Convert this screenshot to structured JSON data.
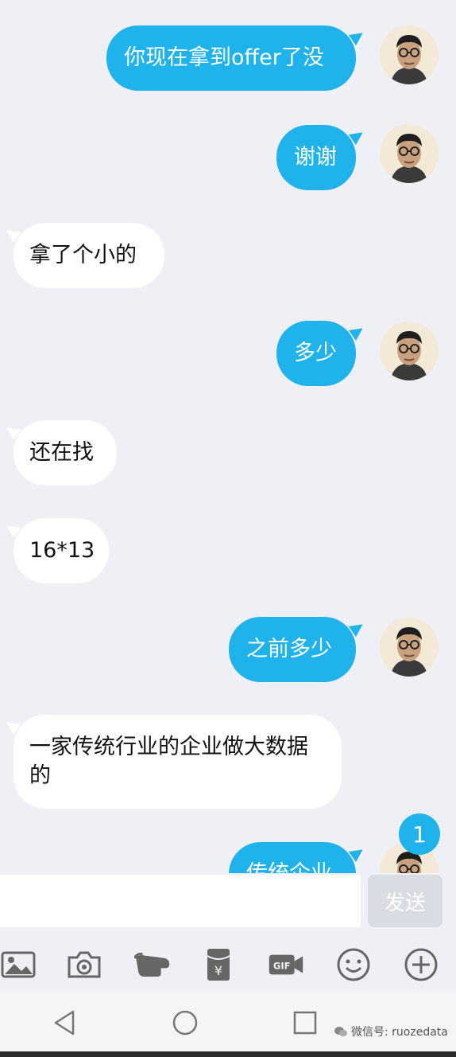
{
  "messages": [
    {
      "side": "sent",
      "text": "你现在拿到offer了没"
    },
    {
      "side": "sent",
      "text": "谢谢"
    },
    {
      "side": "recv",
      "text": "拿了个小的"
    },
    {
      "side": "sent",
      "text": "多少"
    },
    {
      "side": "recv",
      "text": "还在找"
    },
    {
      "side": "recv",
      "text": "16*13"
    },
    {
      "side": "sent",
      "text": "之前多少"
    },
    {
      "side": "recv",
      "text": "一家传统行业的企业做大数据的"
    },
    {
      "side": "sent",
      "text": "传统企业"
    }
  ],
  "unread_badge": "1",
  "input": {
    "value": "",
    "placeholder": ""
  },
  "send_label": "发送",
  "toolbar_icons": [
    "image-icon",
    "camera-icon",
    "poke-icon",
    "red-packet-icon",
    "gif-icon",
    "emoji-icon",
    "plus-icon"
  ],
  "nav_icons": [
    "back-icon",
    "home-icon",
    "recents-icon"
  ],
  "watermark": "微信号: ruozedata",
  "colors": {
    "accent": "#20b2ea",
    "background": "#eef0f5",
    "received_bubble": "#ffffff",
    "send_disabled": "#d9dce3"
  }
}
